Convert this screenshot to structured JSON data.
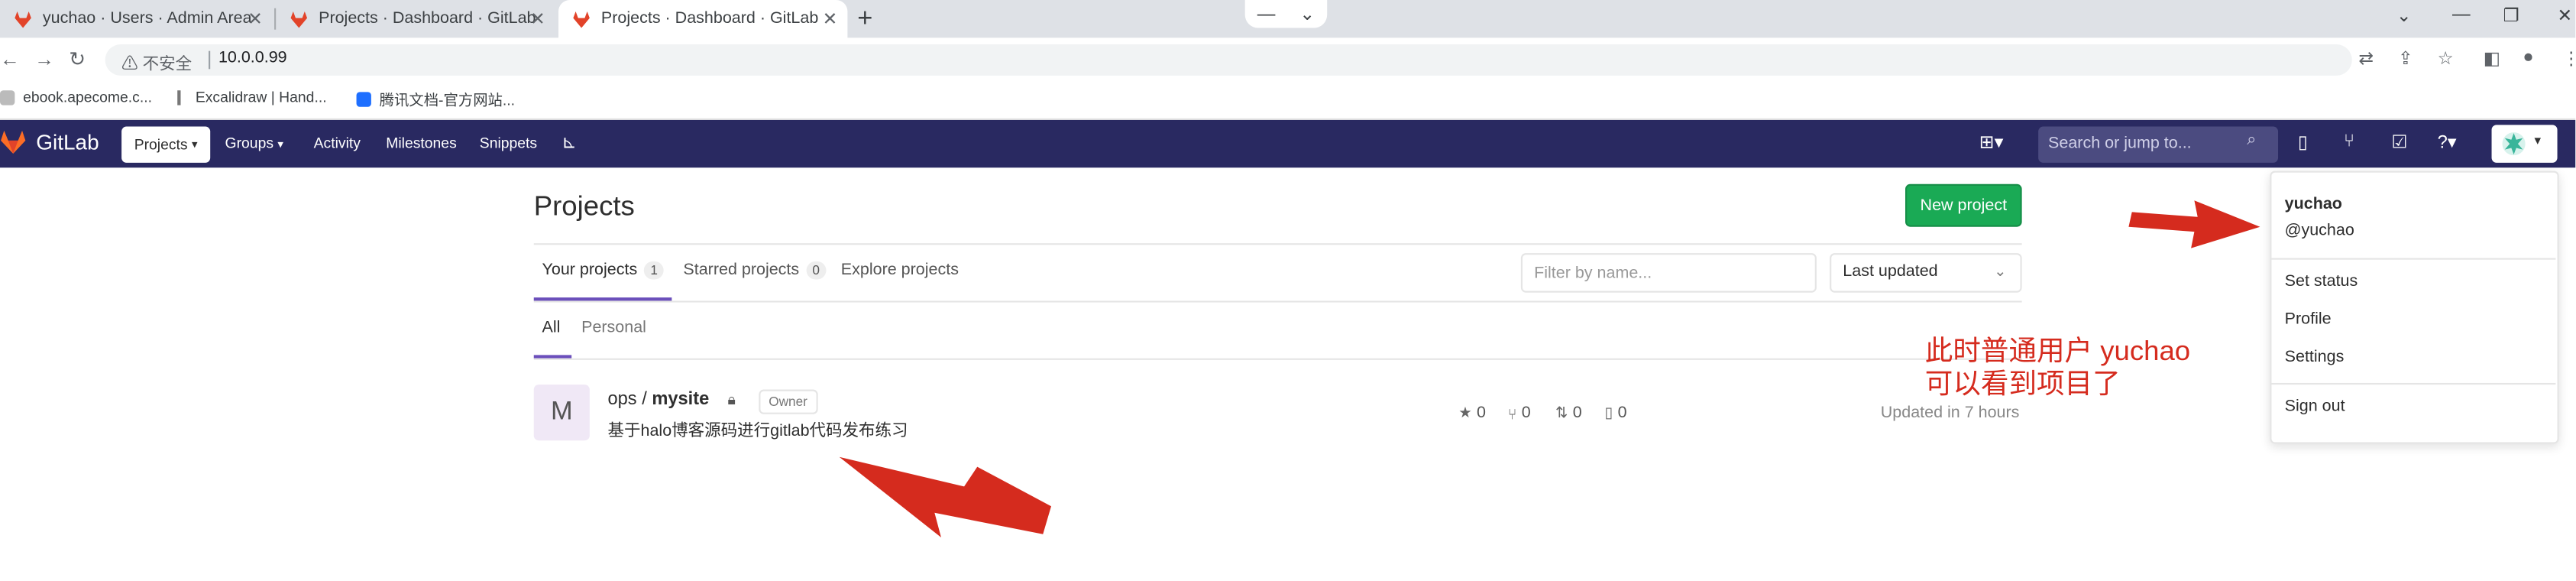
{
  "browser": {
    "tabs": [
      {
        "title": "yuchao · Users · Admin Area · G"
      },
      {
        "title": "Projects · Dashboard · GitLab"
      },
      {
        "title": "Projects · Dashboard · GitLab"
      }
    ],
    "new_tab_symbol": "+",
    "window_controls": [
      "⌄",
      "—",
      "❐",
      "✕"
    ],
    "security_label": "不安全",
    "url": "10.0.0.99",
    "bookmarks": [
      {
        "label": "ebook.apecome.c..."
      },
      {
        "label": "Excalidraw | Hand..."
      },
      {
        "label": "腾讯文档-官方网站..."
      }
    ]
  },
  "gitlab_nav": {
    "brand": "GitLab",
    "items": [
      {
        "label": "Projects"
      },
      {
        "label": "Groups"
      },
      {
        "label": "Activity"
      },
      {
        "label": "Milestones"
      },
      {
        "label": "Snippets"
      }
    ],
    "search_placeholder": "Search or jump to...",
    "accent": "#292961"
  },
  "page": {
    "title": "Projects",
    "new_project_label": "New project",
    "tabs": [
      {
        "label": "Your projects",
        "count": "1"
      },
      {
        "label": "Starred projects",
        "count": "0"
      },
      {
        "label": "Explore projects"
      }
    ],
    "filter_placeholder": "Filter by name...",
    "sort_label": "Last updated",
    "subtabs": [
      {
        "label": "All"
      },
      {
        "label": "Personal"
      }
    ],
    "project": {
      "avatar_letter": "M",
      "namespace": "ops / ",
      "name": "mysite",
      "role": "Owner",
      "description": "基于halo博客源码进行gitlab代码发布练习",
      "stars": "0",
      "forks": "0",
      "merge_requests": "0",
      "issues": "0",
      "updated": "Updated in 7 hours"
    }
  },
  "user_menu": {
    "username": "yuchao",
    "handle": "@yuchao",
    "items": [
      {
        "label": "Set status"
      },
      {
        "label": "Profile"
      },
      {
        "label": "Settings"
      }
    ],
    "sign_out": "Sign out"
  },
  "annotation": {
    "line1": "此时普通用户 yuchao",
    "line2": "可以看到项目了",
    "color": "#d52b1e"
  }
}
